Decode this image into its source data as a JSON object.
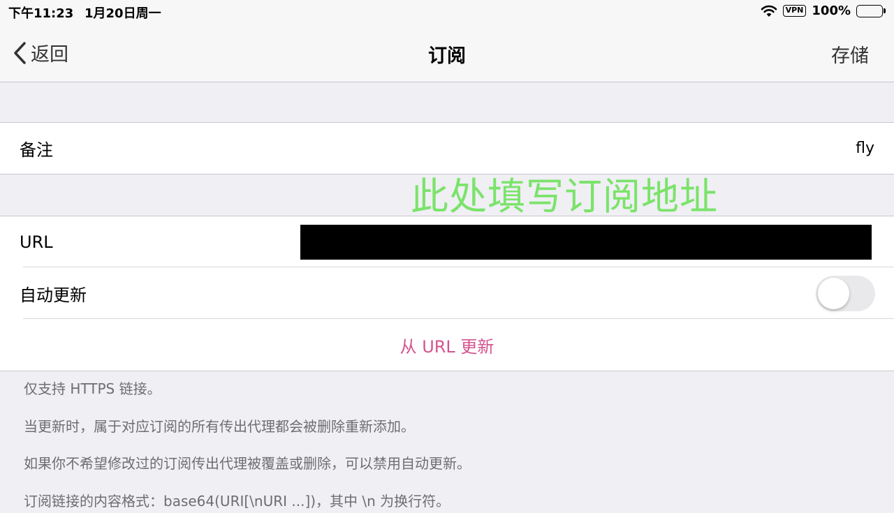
{
  "status_bar": {
    "time": "下午11:23",
    "date": "1月20日周一",
    "vpn": "VPN",
    "battery": "100%"
  },
  "nav": {
    "back_label": "返回",
    "title": "订阅",
    "save_label": "存储"
  },
  "remark_row": {
    "label": "备注",
    "value": "fly"
  },
  "annotation": "此处填写订阅地址",
  "url_row": {
    "label": "URL"
  },
  "auto_update_row": {
    "label": "自动更新",
    "enabled": false
  },
  "update_action": "从 URL 更新",
  "notes": [
    "仅支持 HTTPS 链接。",
    "当更新时，属于对应订阅的所有传出代理都会被删除重新添加。",
    "如果你不希望修改过的订阅传出代理被覆盖或删除，可以禁用自动更新。",
    "订阅链接的内容格式：base64(URI[\\nURI ...])，其中 \\n 为换行符。"
  ],
  "colors": {
    "accent": "#d4558f",
    "annotation": "#7be36a",
    "background": "#efeff4"
  }
}
